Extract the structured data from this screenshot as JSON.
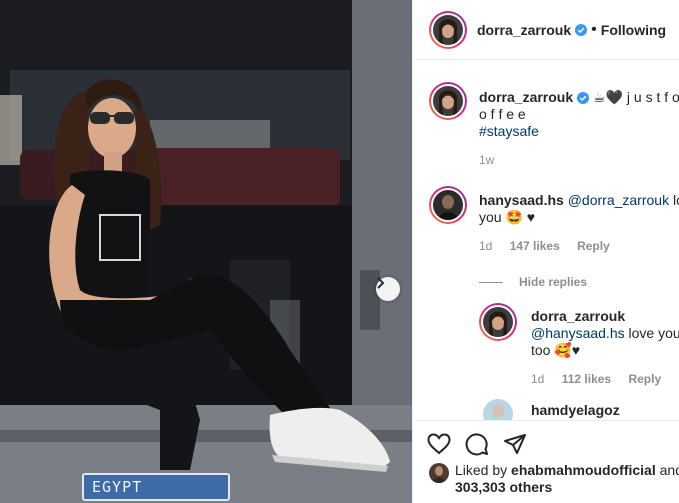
{
  "photo": {
    "plate_text": "EGYPT",
    "next_icon": "chevron-right-icon"
  },
  "header": {
    "username": "dorra_zarrouk",
    "separator": "•",
    "follow_status": "Following"
  },
  "caption": {
    "username": "dorra_zarrouk",
    "emojis": "☕🖤",
    "text_line1": "j u s t f o",
    "text_line2": "o f f e e",
    "hashtag": "#staysafe",
    "time": "1w"
  },
  "comment": {
    "username": "hanysaad.hs",
    "mention": "@dorra_zarrouk",
    "text_line1_rest": " love",
    "text_line2": "you 🤩 ♥",
    "time": "1d",
    "likes": "147 likes",
    "reply_label": "Reply",
    "hide_replies": "Hide replies"
  },
  "reply": {
    "username": "dorra_zarrouk",
    "mention": "@hanysaad.hs",
    "text_rest": " love you",
    "text_line2": "too 🥰♥",
    "time": "1d",
    "likes": "112 likes",
    "reply_label": "Reply"
  },
  "next_comment": {
    "username": "hamdyelagoz"
  },
  "actions": {
    "like_icon": "heart-icon",
    "comment_icon": "comment-icon",
    "share_icon": "share-icon"
  },
  "liked_by": {
    "prefix": "Liked by ",
    "username": "ehabmahmoudofficial",
    "and": " and",
    "count": "303,303 others"
  },
  "colors": {
    "link": "#00376b",
    "meta": "#8e8e8e",
    "verified": "#3897f0",
    "plate": "#3f6aa8"
  }
}
